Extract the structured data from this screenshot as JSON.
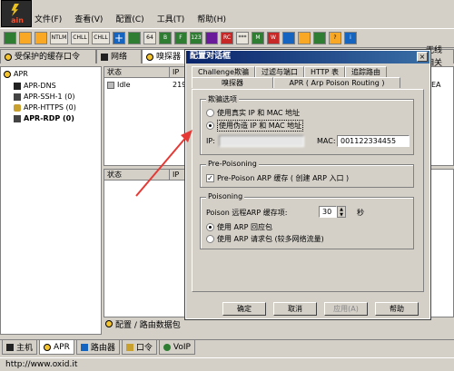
{
  "app": {
    "logo_text": "ain",
    "menu": [
      "文件(F)",
      "查看(V)",
      "配置(C)",
      "工具(T)",
      "帮助(H)"
    ]
  },
  "toolbar": {
    "buttons": [
      "NTLM AUTH",
      "CHLL SPEED RESET",
      "CHLL SPEED NTLM",
      "+",
      "64",
      "B",
      "F",
      "123",
      "RC",
      "***",
      "M",
      "W",
      "?",
      "i"
    ]
  },
  "main_tabs": [
    "受保护的缓存口令",
    "网络",
    "嗅探器",
    "无线相关"
  ],
  "tree": {
    "root": "APR",
    "items": [
      "APR-DNS",
      "APR-SSH-1  (0)",
      "APR-HTTPS  (0)",
      "APR-RDP  (0)"
    ]
  },
  "table": {
    "top_headers": [
      "状态",
      "IP"
    ],
    "row_status": "Idle",
    "row_ip": "219.",
    "right_edge_text": "EA",
    "bottom_headers": [
      "状态",
      "IP"
    ]
  },
  "bottom_pane_tab": "配置 / 路由数据包",
  "bottom_tabs": [
    "主机",
    "APR",
    "路由器",
    "口令",
    "VoIP"
  ],
  "status_url": "http://www.oxid.it",
  "dialog": {
    "title": "配置对话框",
    "close_label": "×",
    "tabs_row1": [
      "Challenge欺骗",
      "过滤与端口",
      "HTTP 表",
      "追踪路由"
    ],
    "tabs_row2": [
      "嗅探器",
      "APR ( Arp Poison Routing )"
    ],
    "spoof_group": "欺骗选项",
    "opt_real": "使用真实 IP 和 MAC 地址",
    "opt_fake": "使用伪造 IP 和 MAC 地址",
    "ip_label": "IP:",
    "ip_value": "",
    "mac_label": "MAC:",
    "mac_value": "001122334455",
    "prepoison_group": "Pre-Poisoning",
    "prepoison_label": "Pre-Poison ARP 缓存 ( 创建 ARP 入口 )",
    "prepoison_checked": true,
    "poisoning_group": "Poisoning",
    "refresh_label": "Poison 远程ARP 缓存项:",
    "refresh_value": "30",
    "refresh_unit": "秒",
    "opt_reply": "使用 ARP 回应包",
    "opt_request": "使用 ARP 请求包 (较多网络流量)",
    "buttons": {
      "ok": "确定",
      "cancel": "取消",
      "apply": "应用(A)",
      "help": "帮助"
    }
  },
  "colors": {
    "title_start": "#0a246a",
    "title_end": "#3a6ea5",
    "arrow": "#e53935"
  }
}
